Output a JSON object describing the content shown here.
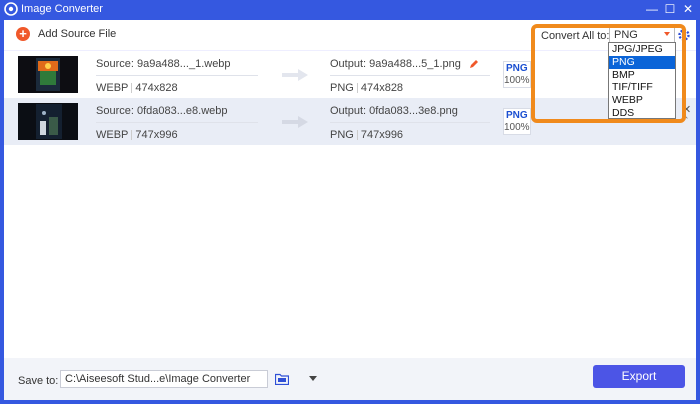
{
  "window": {
    "title": "Image Converter",
    "minimize": "—",
    "maximize": "☐",
    "close": "✕"
  },
  "toolbar": {
    "add_plus": "+",
    "add_label": "Add Source File",
    "convert_all_label": "Convert All to:",
    "convert_all_value": "PNG"
  },
  "dropdown": {
    "options": [
      "JPG/JPEG",
      "PNG",
      "BMP",
      "TIF/TIFF",
      "WEBP",
      "DDS"
    ],
    "selected": "PNG"
  },
  "files": [
    {
      "source": "Source: 9a9a488..._1.webp",
      "source_format": "WEBP",
      "source_size": "474x828",
      "output": "Output: 9a9a488...5_1.png",
      "output_format": "PNG",
      "output_size": "474x828",
      "badge_format": "PNG",
      "badge_percent": "100%"
    },
    {
      "source": "Source: 0fda083...e8.webp",
      "source_format": "WEBP",
      "source_size": "747x996",
      "output": "Output: 0fda083...3e8.png",
      "output_format": "PNG",
      "output_size": "747x996",
      "badge_format": "PNG",
      "badge_percent": "100%"
    }
  ],
  "footer": {
    "save_to_label": "Save to:",
    "save_path": "C:\\Aiseesoft Stud...e\\Image Converter",
    "export_label": "Export"
  },
  "colors": {
    "titlebar": "#3558e0",
    "accent_orange": "#f0582a",
    "highlight": "#f08a1c",
    "export": "#4c55e6",
    "selected": "#0a64d8"
  }
}
